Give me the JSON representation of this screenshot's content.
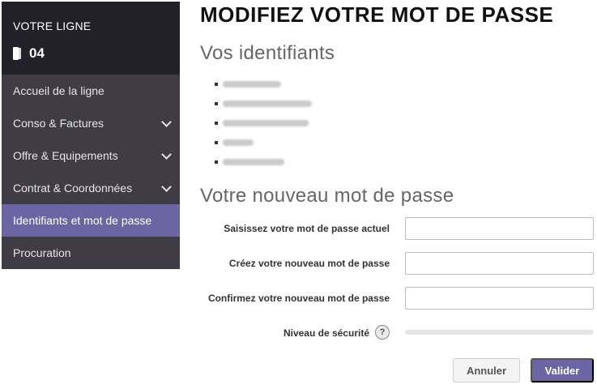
{
  "sidebar": {
    "title": "VOTRE LIGNE",
    "line_number": "04",
    "items": [
      {
        "label": "Accueil de la ligne"
      },
      {
        "label": "Conso & Factures"
      },
      {
        "label": "Offre & Equipements"
      },
      {
        "label": "Contrat & Coordonnées"
      },
      {
        "label": "Identifiants et mot de passe"
      },
      {
        "label": "Procuration"
      }
    ],
    "active_item": "Identifiants et mot de passe"
  },
  "main": {
    "page_title": "MODIFIEZ VOTRE MOT DE PASSE",
    "identifiers_title": "Vos identifiants",
    "new_password_title": "Votre nouveau mot de passe",
    "form": {
      "current_password_label": "Saisissez votre mot de passe actuel",
      "new_password_label": "Créez votre nouveau mot de passe",
      "confirm_password_label": "Confirmez votre nouveau mot de passe",
      "security_level_label": "Niveau de sécurité",
      "help_icon": "?"
    },
    "buttons": {
      "cancel": "Annuler",
      "submit": "Valider"
    }
  },
  "colors": {
    "sidebar_header_bg": "#222028",
    "sidebar_menu_bg": "#3f3c46",
    "accent": "#6b66a3"
  },
  "icons": {
    "line": "phone-icon",
    "submenu": "chevron-down-icon",
    "help": "help-icon"
  }
}
